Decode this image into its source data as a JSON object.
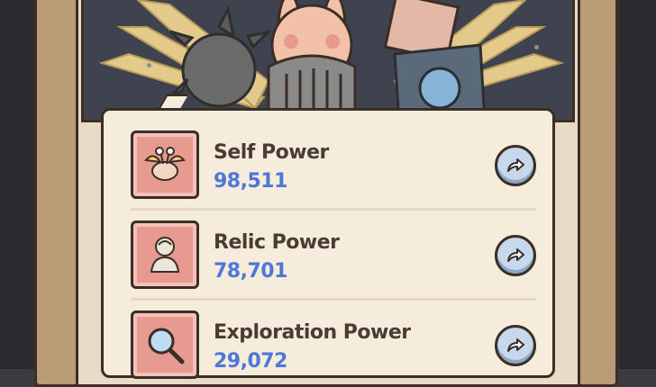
{
  "colors": {
    "panel_bg": "#f5ecdc",
    "tile_bg": "#e79a8f",
    "label_color": "#4a3c34",
    "value_color": "#4f76d9",
    "button_bg": "#c7d7ec"
  },
  "powers": [
    {
      "label": "Self Power",
      "value": "98,511",
      "icon": "winged-snail-icon"
    },
    {
      "label": "Relic Power",
      "value": "78,701",
      "icon": "statue-bust-icon"
    },
    {
      "label": "Exploration Power",
      "value": "29,072",
      "icon": "magnifier-icon"
    }
  ]
}
